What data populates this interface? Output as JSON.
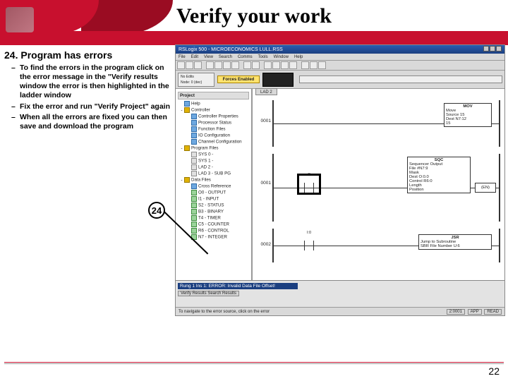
{
  "slide": {
    "title": "Verify your work",
    "page_number": "22"
  },
  "section": {
    "heading": "24. Program has errors",
    "bullets": [
      "To find the errors in the program click on the error message in the \"Verify results window the error is then highlighted in the ladder window",
      "Fix the error and run \"Verify Project\" again",
      "When all the errors are fixed you can then save and download the program"
    ]
  },
  "callout": {
    "label": "24"
  },
  "app": {
    "titlebar": "RSLogix 500 - MICROECONOMICS LULL.RSS",
    "menu": [
      "File",
      "Edit",
      "View",
      "Search",
      "Comms",
      "Tools",
      "Window",
      "Help"
    ],
    "status": {
      "left1": "No Edits",
      "left2": "Forces Enabled",
      "prog": "Node: 0 (dec)"
    },
    "tree": {
      "project": "Project",
      "items": [
        {
          "t": "Help",
          "i": "cfg"
        },
        {
          "t": "Controller",
          "i": "folder",
          "exp": "-"
        },
        {
          "t": "Controller Properties",
          "i": "cfg",
          "ind": 1
        },
        {
          "t": "Processor Status",
          "i": "cfg",
          "ind": 1
        },
        {
          "t": "Function Files",
          "i": "cfg",
          "ind": 1
        },
        {
          "t": "IO Configuration",
          "i": "cfg",
          "ind": 1
        },
        {
          "t": "Channel Configuration",
          "i": "cfg",
          "ind": 1
        },
        {
          "t": "Program Files",
          "i": "folder",
          "exp": "-"
        },
        {
          "t": "SYS 0 -",
          "i": "pf",
          "ind": 1
        },
        {
          "t": "SYS 1 -",
          "i": "pf",
          "ind": 1
        },
        {
          "t": "LAD 2 -",
          "i": "pf",
          "ind": 1
        },
        {
          "t": "LAD 3 - SUB PG",
          "i": "pf",
          "ind": 1
        },
        {
          "t": "Data Files",
          "i": "folder",
          "exp": "-"
        },
        {
          "t": "Cross Reference",
          "i": "cfg",
          "ind": 1
        },
        {
          "t": "O0 - OUTPUT",
          "i": "df",
          "ind": 1
        },
        {
          "t": "I1 - INPUT",
          "i": "df",
          "ind": 1
        },
        {
          "t": "S2 - STATUS",
          "i": "df",
          "ind": 1
        },
        {
          "t": "B3 - BINARY",
          "i": "df",
          "ind": 1
        },
        {
          "t": "T4 - TIMER",
          "i": "df",
          "ind": 1
        },
        {
          "t": "C5 - COUNTER",
          "i": "df",
          "ind": 1
        },
        {
          "t": "R6 - CONTROL",
          "i": "df",
          "ind": 1
        },
        {
          "t": "N7 - INTEGER",
          "i": "df",
          "ind": 1
        }
      ]
    },
    "ladder": {
      "tab": "LAD 2",
      "rungs": [
        {
          "id": "0001",
          "box": {
            "hdr": "MOV",
            "lines": [
              "Move",
              "Source        15",
              "",
              "Dest      N7:12",
              "       15"
            ]
          }
        },
        {
          "id": "0001",
          "box": {
            "hdr": "SQC",
            "lines": [
              "Sequencer Output",
              "File     #N7:9",
              "Mask",
              "Dest      O:0.0",
              "Control    R6:0",
              "Length",
              "Position"
            ]
          },
          "coil": "(EN)",
          "contact": "C"
        },
        {
          "id": "0002",
          "box": {
            "hdr": "JSR",
            "lines": [
              "Jump to Subroutine",
              "SBR File Number    U:6"
            ]
          },
          "contact": "I:0"
        }
      ]
    },
    "verify": {
      "error": "Rung 1 Ins 1: ERROR: Invalid Data File Offset!",
      "tabs": "Verify Results   Search Results"
    },
    "statusbar": {
      "left": "To navigate to the error source, click on the error",
      "r1": "2:0001",
      "r2": "APP",
      "r3": "READ"
    }
  }
}
